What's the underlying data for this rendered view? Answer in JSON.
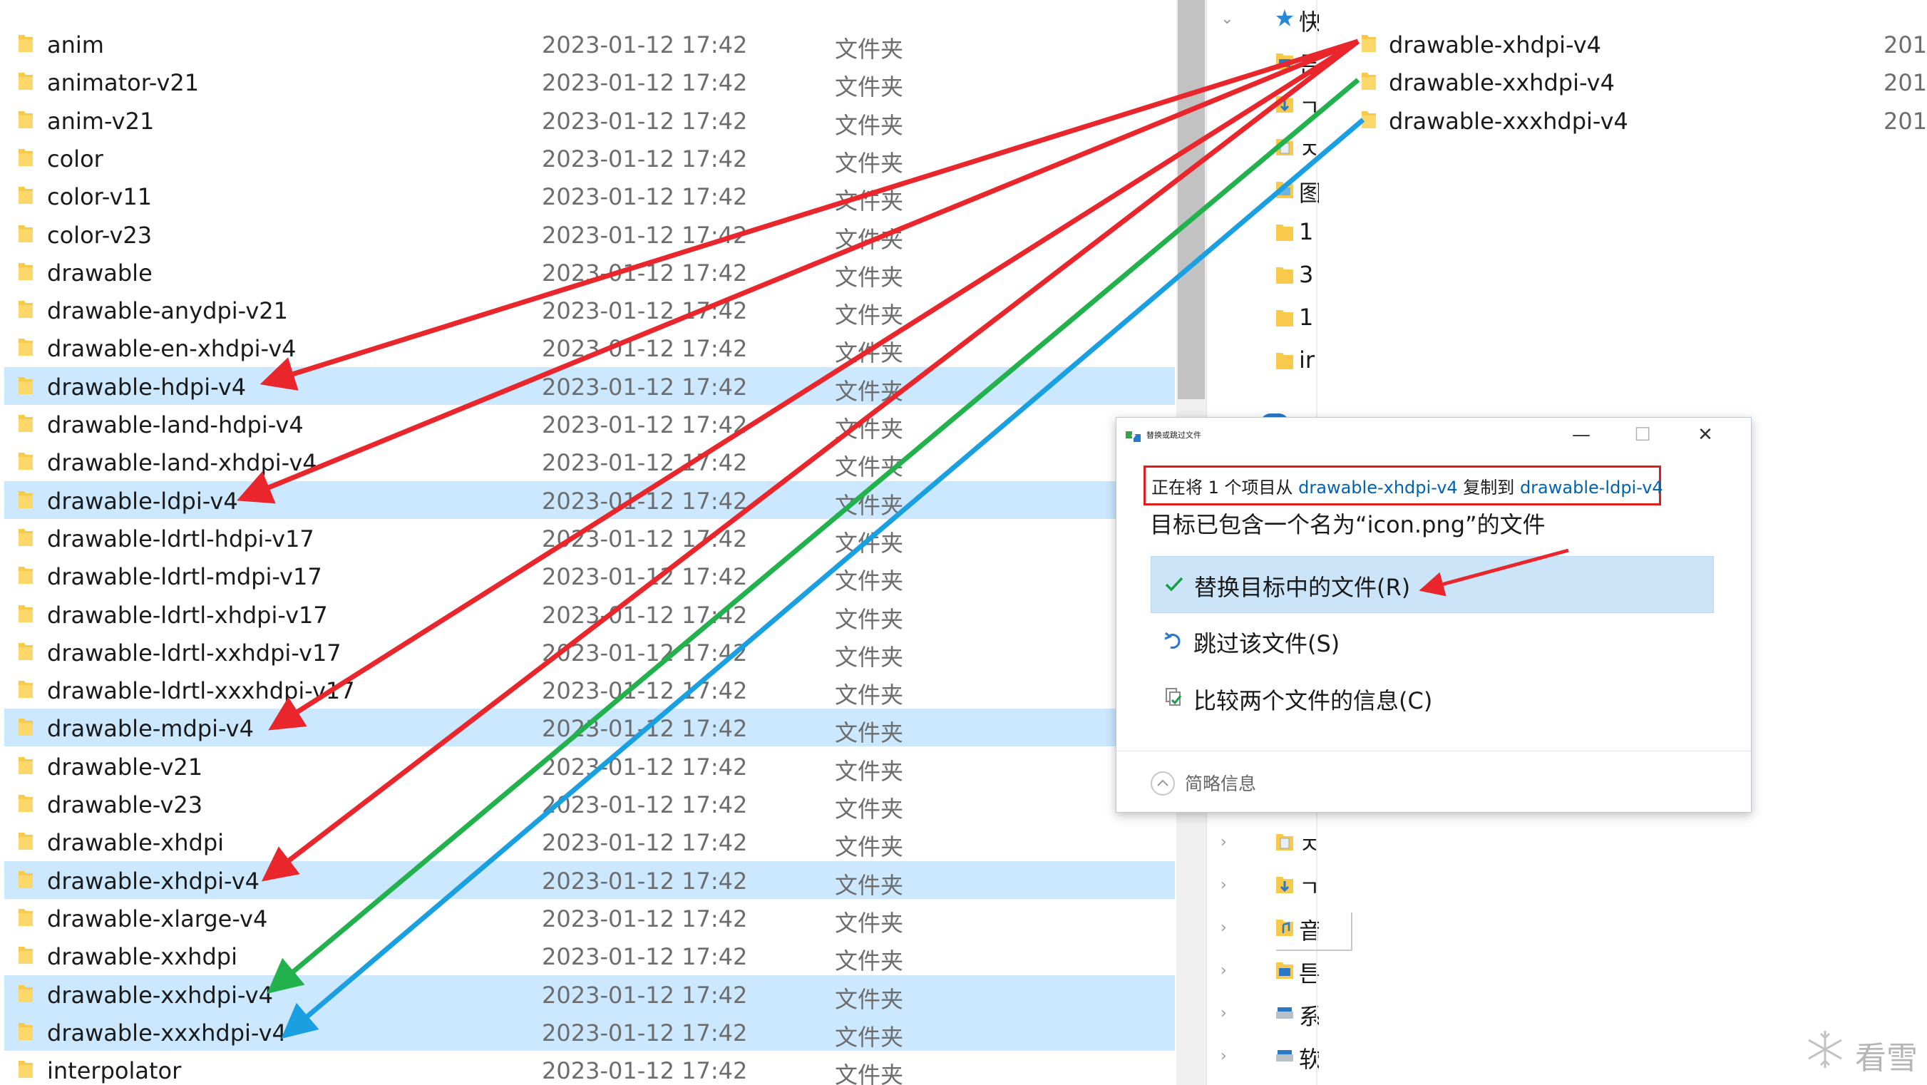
{
  "left_files": [
    {
      "name": "anim",
      "date": "2023-01-12 17:42",
      "type": "文件夹",
      "selected": false
    },
    {
      "name": "animator-v21",
      "date": "2023-01-12 17:42",
      "type": "文件夹",
      "selected": false
    },
    {
      "name": "anim-v21",
      "date": "2023-01-12 17:42",
      "type": "文件夹",
      "selected": false
    },
    {
      "name": "color",
      "date": "2023-01-12 17:42",
      "type": "文件夹",
      "selected": false
    },
    {
      "name": "color-v11",
      "date": "2023-01-12 17:42",
      "type": "文件夹",
      "selected": false
    },
    {
      "name": "color-v23",
      "date": "2023-01-12 17:42",
      "type": "文件夹",
      "selected": false
    },
    {
      "name": "drawable",
      "date": "2023-01-12 17:42",
      "type": "文件夹",
      "selected": false
    },
    {
      "name": "drawable-anydpi-v21",
      "date": "2023-01-12 17:42",
      "type": "文件夹",
      "selected": false
    },
    {
      "name": "drawable-en-xhdpi-v4",
      "date": "2023-01-12 17:42",
      "type": "文件夹",
      "selected": false
    },
    {
      "name": "drawable-hdpi-v4",
      "date": "2023-01-12 17:42",
      "type": "文件夹",
      "selected": true
    },
    {
      "name": "drawable-land-hdpi-v4",
      "date": "2023-01-12 17:42",
      "type": "文件夹",
      "selected": false
    },
    {
      "name": "drawable-land-xhdpi-v4",
      "date": "2023-01-12 17:42",
      "type": "文件夹",
      "selected": false
    },
    {
      "name": "drawable-ldpi-v4",
      "date": "2023-01-12 17:42",
      "type": "文件夹",
      "selected": true
    },
    {
      "name": "drawable-ldrtl-hdpi-v17",
      "date": "2023-01-12 17:42",
      "type": "文件夹",
      "selected": false
    },
    {
      "name": "drawable-ldrtl-mdpi-v17",
      "date": "2023-01-12 17:42",
      "type": "文件夹",
      "selected": false
    },
    {
      "name": "drawable-ldrtl-xhdpi-v17",
      "date": "2023-01-12 17:42",
      "type": "文件夹",
      "selected": false
    },
    {
      "name": "drawable-ldrtl-xxhdpi-v17",
      "date": "2023-01-12 17:42",
      "type": "文件夹",
      "selected": false
    },
    {
      "name": "drawable-ldrtl-xxxhdpi-v17",
      "date": "2023-01-12 17:42",
      "type": "文件夹",
      "selected": false
    },
    {
      "name": "drawable-mdpi-v4",
      "date": "2023-01-12 17:42",
      "type": "文件夹",
      "selected": true
    },
    {
      "name": "drawable-v21",
      "date": "2023-01-12 17:42",
      "type": "文件夹",
      "selected": false
    },
    {
      "name": "drawable-v23",
      "date": "2023-01-12 17:42",
      "type": "文件夹",
      "selected": false
    },
    {
      "name": "drawable-xhdpi",
      "date": "2023-01-12 17:42",
      "type": "文件夹",
      "selected": false
    },
    {
      "name": "drawable-xhdpi-v4",
      "date": "2023-01-12 17:42",
      "type": "文件夹",
      "selected": true
    },
    {
      "name": "drawable-xlarge-v4",
      "date": "2023-01-12 17:42",
      "type": "文件夹",
      "selected": false
    },
    {
      "name": "drawable-xxhdpi",
      "date": "2023-01-12 17:42",
      "type": "文件夹",
      "selected": false
    },
    {
      "name": "drawable-xxhdpi-v4",
      "date": "2023-01-12 17:42",
      "type": "文件夹",
      "selected": true
    },
    {
      "name": "drawable-xxxhdpi-v4",
      "date": "2023-01-12 17:42",
      "type": "文件夹",
      "selected": true
    },
    {
      "name": "interpolator",
      "date": "2023-01-12 17:42",
      "type": "文件夹",
      "selected": false
    }
  ],
  "nav_items": [
    {
      "icon": "quick-access-star-icon",
      "text": "快",
      "chevron": "⌄"
    },
    {
      "icon": "desktop-folder-icon",
      "text": "튼",
      "chevron": ""
    },
    {
      "icon": "downloads-folder-icon",
      "text": "ㄱ",
      "chevron": ""
    },
    {
      "icon": "documents-folder-icon",
      "text": "ㅈ",
      "chevron": ""
    },
    {
      "icon": "pictures-folder-icon",
      "text": "图",
      "chevron": ""
    },
    {
      "icon": "folder-icon",
      "text": "1",
      "chevron": ""
    },
    {
      "icon": "folder-icon",
      "text": "3",
      "chevron": ""
    },
    {
      "icon": "folder-icon",
      "text": "1",
      "chevron": ""
    },
    {
      "icon": "folder-icon",
      "text": "ir",
      "chevron": ""
    }
  ],
  "nav_items_bottom": [
    {
      "icon": "documents-folder-icon",
      "text": "ㅈ",
      "chevron": "›"
    },
    {
      "icon": "downloads-folder-icon",
      "text": "ㄱ",
      "chevron": "›"
    },
    {
      "icon": "music-folder-icon",
      "text": "音",
      "chevron": "›"
    },
    {
      "icon": "desktop-folder-icon",
      "text": "튼",
      "chevron": "›"
    },
    {
      "icon": "local-disk-icon",
      "text": "系",
      "chevron": "›"
    },
    {
      "icon": "drive-icon",
      "text": "软",
      "chevron": "›"
    }
  ],
  "right_files": [
    {
      "name": "drawable-xhdpi-v4",
      "date": "201"
    },
    {
      "name": "drawable-xxhdpi-v4",
      "date": "201"
    },
    {
      "name": "drawable-xxxhdpi-v4",
      "date": "201"
    }
  ],
  "dialog": {
    "title": "替换或跳过文件",
    "copy_prefix": "正在将 1 个项目从 ",
    "copy_source": "drawable-xhdpi-v4",
    "copy_mid": " 复制到 ",
    "copy_dest": "drawable-ldpi-v4",
    "message": "目标已包含一个名为“icon.png”的文件",
    "replace": "替换目标中的文件(R)",
    "skip": "跳过该文件(S)",
    "compare": "比较两个文件的信息(C)",
    "details": "简略信息",
    "minimize": "—",
    "maximize": "☐",
    "close": "✕"
  },
  "watermark": "看雪",
  "colors": {
    "selection": "#cce8ff",
    "arrow_red": "#e8262c",
    "arrow_green": "#23b14d",
    "arrow_blue": "#1a9fe0",
    "link": "#0063b1",
    "folder": "#f8c94a"
  }
}
